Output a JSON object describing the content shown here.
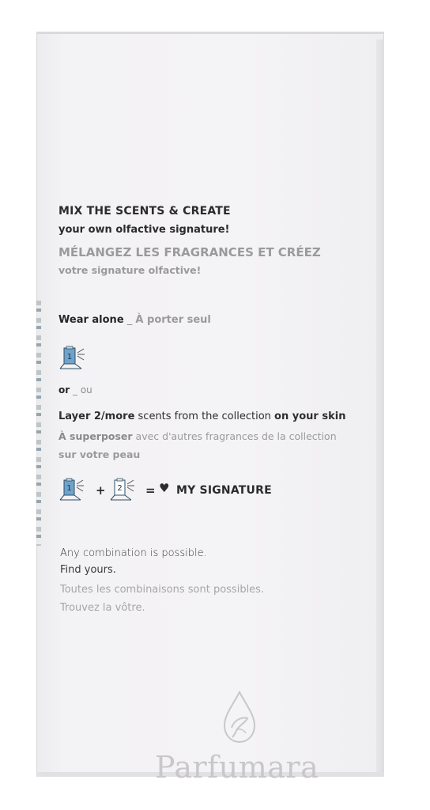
{
  "heading": {
    "en_title": "MIX THE SCENTS & CREATE",
    "en_subtitle": "your own olfactive signature!",
    "fr_title": "MÉLANGEZ LES FRAGRANCES ET CRÉEZ",
    "fr_subtitle": "votre signature olfactive!"
  },
  "wear_alone": {
    "en": "Wear alone",
    "separator": "_",
    "fr": "À porter seul"
  },
  "or_line": {
    "en": "or",
    "separator": "_",
    "fr": "ou"
  },
  "layer": {
    "en_bold_1": "Layer 2/more",
    "en_text": " scents from the collection ",
    "en_bold_2": "on your skin",
    "fr_bold_1": "À superposer",
    "fr_text": " avec d'autres fragrances de la collection",
    "fr_line2": "sur votre peau"
  },
  "equation": {
    "bottle1_label": "1",
    "plus": "+",
    "bottle2_label": "2",
    "equals": "=",
    "result": "MY SIGNATURE"
  },
  "closing": {
    "en_line1": "Any combination is possible.",
    "en_line2": "Find yours.",
    "fr_line1": "Toutes les combinaisons sont possibles.",
    "fr_line2": "Trouvez la vôtre."
  },
  "watermark": {
    "text": "Parfumara"
  },
  "colors": {
    "bottle_blue": "#6fa3cc",
    "text_dark": "#2b2b2b",
    "text_grey": "#9a9a9c"
  }
}
